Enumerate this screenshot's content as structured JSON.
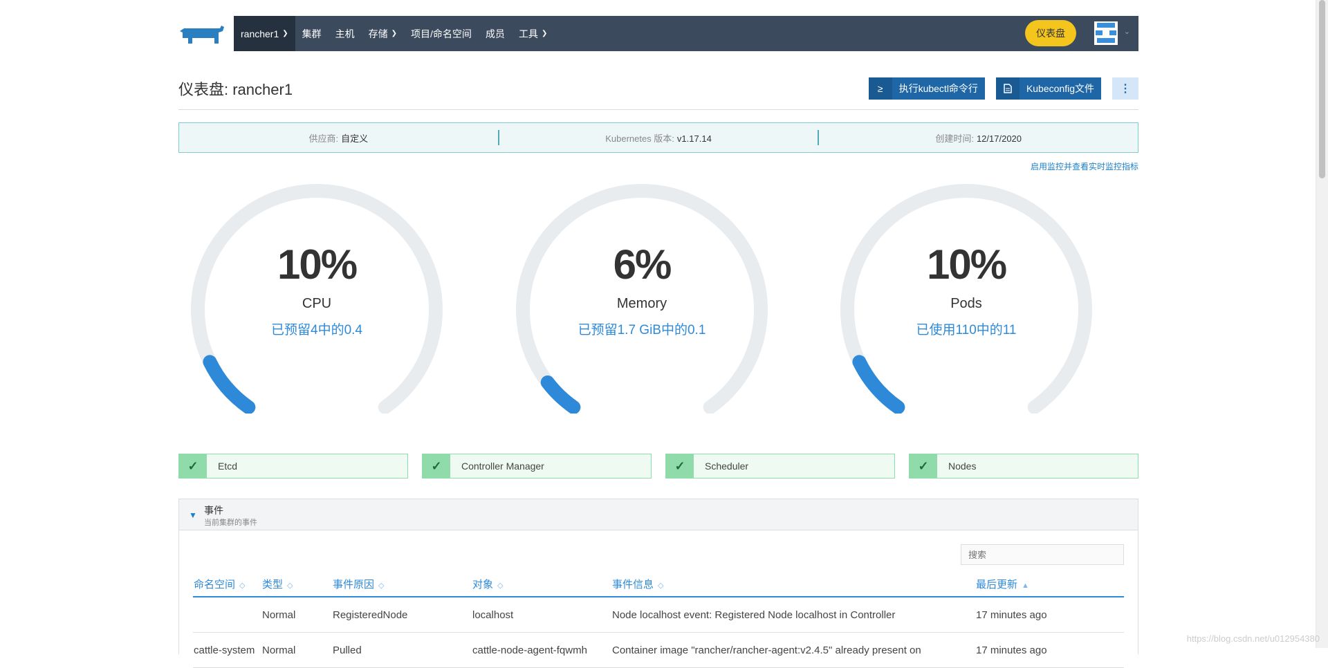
{
  "nav": {
    "items": [
      {
        "label": "rancher1",
        "has_dropdown": true,
        "active": true
      },
      {
        "label": "集群",
        "has_dropdown": false
      },
      {
        "label": "主机",
        "has_dropdown": false
      },
      {
        "label": "存储",
        "has_dropdown": true
      },
      {
        "label": "项目/命名空间",
        "has_dropdown": false
      },
      {
        "label": "成员",
        "has_dropdown": false
      },
      {
        "label": "工具",
        "has_dropdown": true
      }
    ],
    "dashboard_button": "仪表盘"
  },
  "header": {
    "title": "仪表盘: rancher1",
    "kubectl_button": "执行kubectl命令行",
    "kubeconfig_button": "Kubeconfig文件",
    "kubectl_icon": "≥",
    "more_icon": "⋮"
  },
  "info": {
    "provider_label": "供应商:",
    "provider_value": "自定义",
    "k8s_label": "Kubernetes 版本:",
    "k8s_value": "v1.17.14",
    "created_label": "创建时间:",
    "created_value": "12/17/2020"
  },
  "monitor_link": "启用监控并查看实时监控指标",
  "gauges": [
    {
      "percent": "10%",
      "value": 0.1,
      "label": "CPU",
      "sub": "已预留4中的0.4"
    },
    {
      "percent": "6%",
      "value": 0.06,
      "label": "Memory",
      "sub": "已预留1.7 GiB中的0.1"
    },
    {
      "percent": "10%",
      "value": 0.1,
      "label": "Pods",
      "sub": "已使用110中的11"
    }
  ],
  "status": [
    "Etcd",
    "Controller Manager",
    "Scheduler",
    "Nodes"
  ],
  "events": {
    "title": "事件",
    "description": "当前集群的事件",
    "search_placeholder": "搜索",
    "columns": [
      "命名空间",
      "类型",
      "事件原因",
      "对象",
      "事件信息",
      "最后更新"
    ],
    "sort_icons": [
      "◇",
      "◇",
      "◇",
      "◇",
      "◇",
      "▲"
    ],
    "rows": [
      [
        "",
        "Normal",
        "RegisteredNode",
        "localhost",
        "Node localhost event: Registered Node localhost in Controller",
        "17 minutes ago"
      ],
      [
        "cattle-system",
        "Normal",
        "Pulled",
        "cattle-node-agent-fqwmh",
        "Container image \"rancher/rancher-agent:v2.4.5\" already present on",
        "17 minutes ago"
      ]
    ]
  },
  "watermark": "https://blog.csdn.net/u012954380",
  "colors": {
    "nav_bg": "#3b4a5d",
    "accent": "#2e8ad8",
    "gauge_track": "#e9ecee",
    "dashboard_btn": "#f3c51d",
    "ok_green": "#8fdcaa"
  }
}
